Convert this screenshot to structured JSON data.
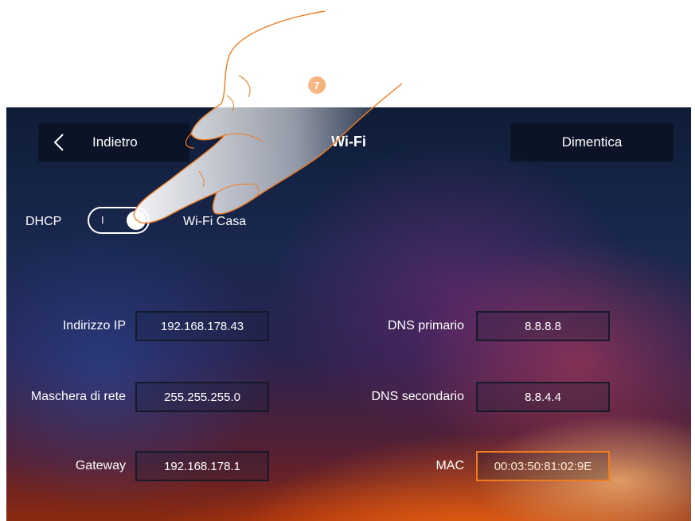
{
  "step_badge": "7",
  "header": {
    "back_label": "Indietro",
    "title": "Wi-Fi",
    "forget_label": "Dimentica"
  },
  "dhcp": {
    "label": "DHCP",
    "toggle_mark": "I",
    "toggle_state": "on",
    "network_name": "Wi-Fi Casa"
  },
  "fields": {
    "ip": {
      "label": "Indirizzo IP",
      "value": "192.168.178.43"
    },
    "netmask": {
      "label": "Maschera di rete",
      "value": "255.255.255.0"
    },
    "gateway": {
      "label": "Gateway",
      "value": "192.168.178.1"
    },
    "dns1": {
      "label": "DNS primario",
      "value": "8.8.8.8"
    },
    "dns2": {
      "label": "DNS secondario",
      "value": "8.8.4.4"
    },
    "mac": {
      "label": "MAC",
      "value": "00:03:50:81:02:9E"
    }
  },
  "icons": {
    "back": "chevron-left-icon"
  },
  "colors": {
    "accent": "#f07c1f",
    "button_bg": "#0a1223",
    "text": "#ffffff"
  }
}
